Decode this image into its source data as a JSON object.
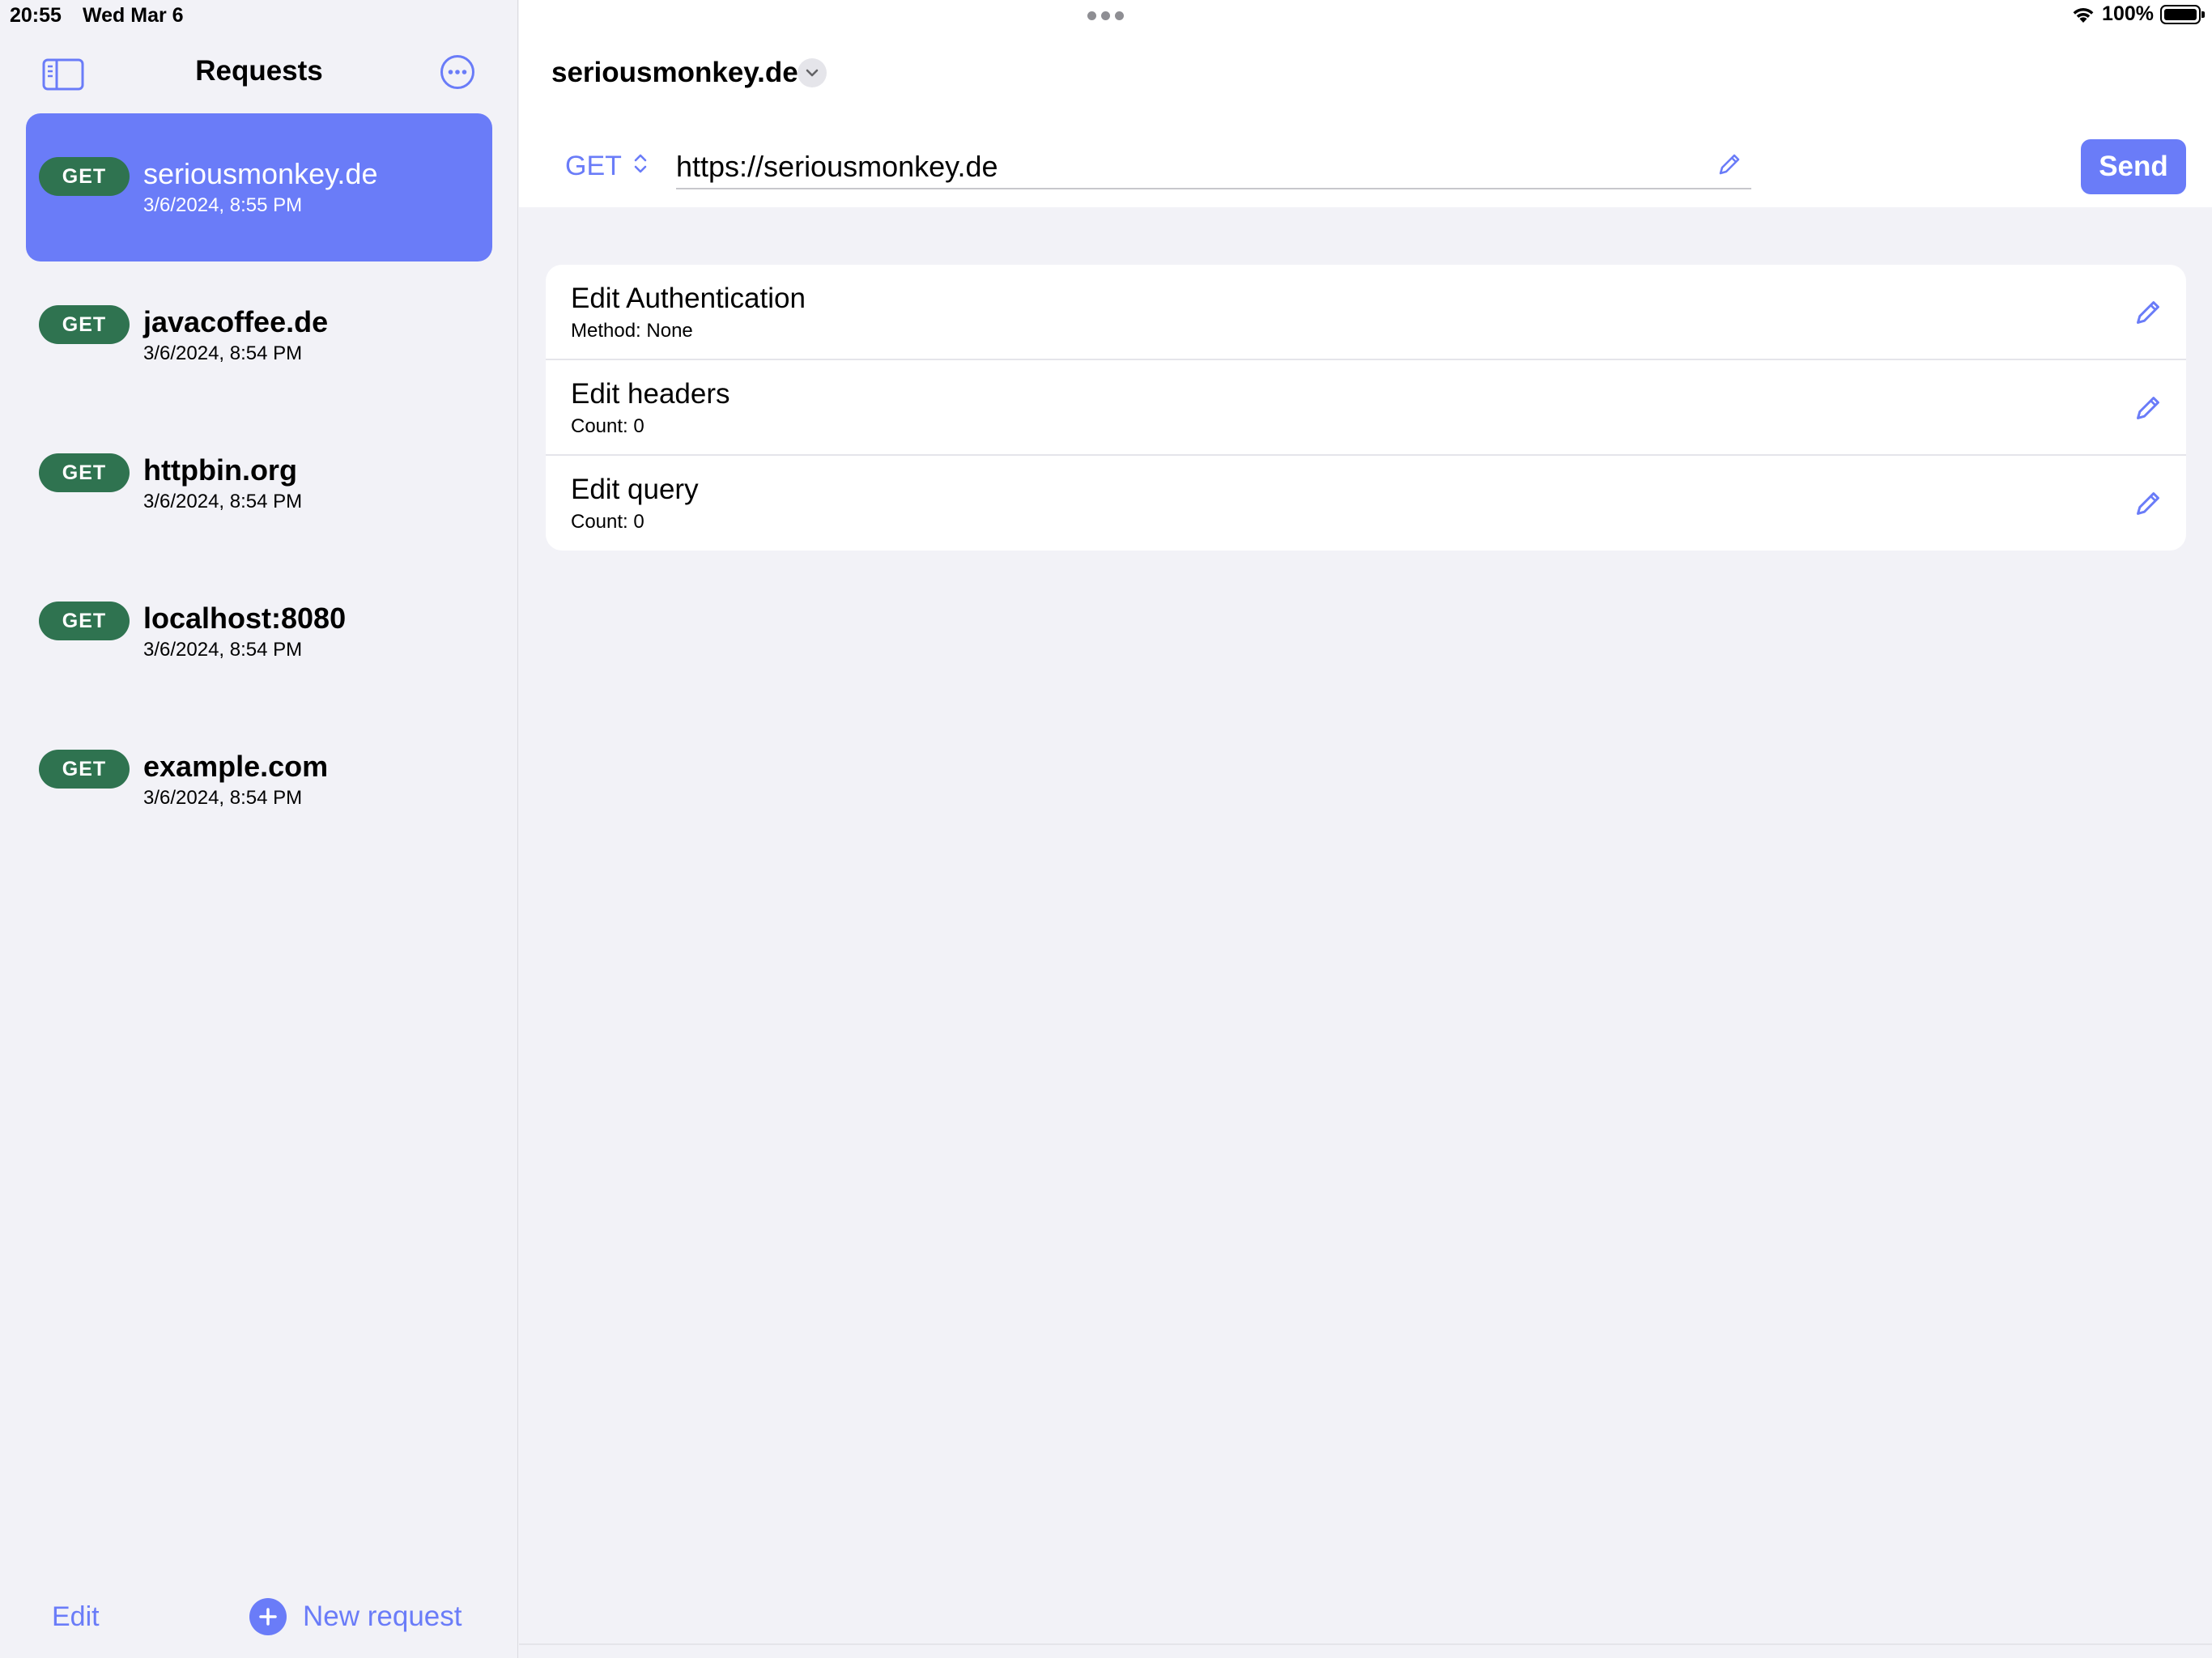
{
  "status_bar": {
    "time": "20:55",
    "date": "Wed Mar 6",
    "battery": "100%"
  },
  "sidebar": {
    "title": "Requests",
    "requests": [
      {
        "method": "GET",
        "host": "seriousmonkey.de",
        "date": "3/6/2024, 8:55 PM",
        "selected": true
      },
      {
        "method": "GET",
        "host": "javacoffee.de",
        "date": "3/6/2024, 8:54 PM"
      },
      {
        "method": "GET",
        "host": "httpbin.org",
        "date": "3/6/2024, 8:54 PM"
      },
      {
        "method": "GET",
        "host": "localhost:8080",
        "date": "3/6/2024, 8:54 PM"
      },
      {
        "method": "GET",
        "host": "example.com",
        "date": "3/6/2024, 8:54 PM"
      }
    ],
    "footer": {
      "edit_label": "Edit",
      "new_request_label": "New request"
    }
  },
  "main": {
    "title": "seriousmonkey.de",
    "method": "GET",
    "url": "https://seriousmonkey.de",
    "send_label": "Send",
    "options": [
      {
        "title": "Edit Authentication",
        "subtitle": "Method: None"
      },
      {
        "title": "Edit headers",
        "subtitle": "Count: 0"
      },
      {
        "title": "Edit query",
        "subtitle": "Count: 0"
      }
    ]
  },
  "colors": {
    "accent": "#6a7cf8",
    "method_badge": "#2f7350",
    "background": "#f2f2f7"
  }
}
